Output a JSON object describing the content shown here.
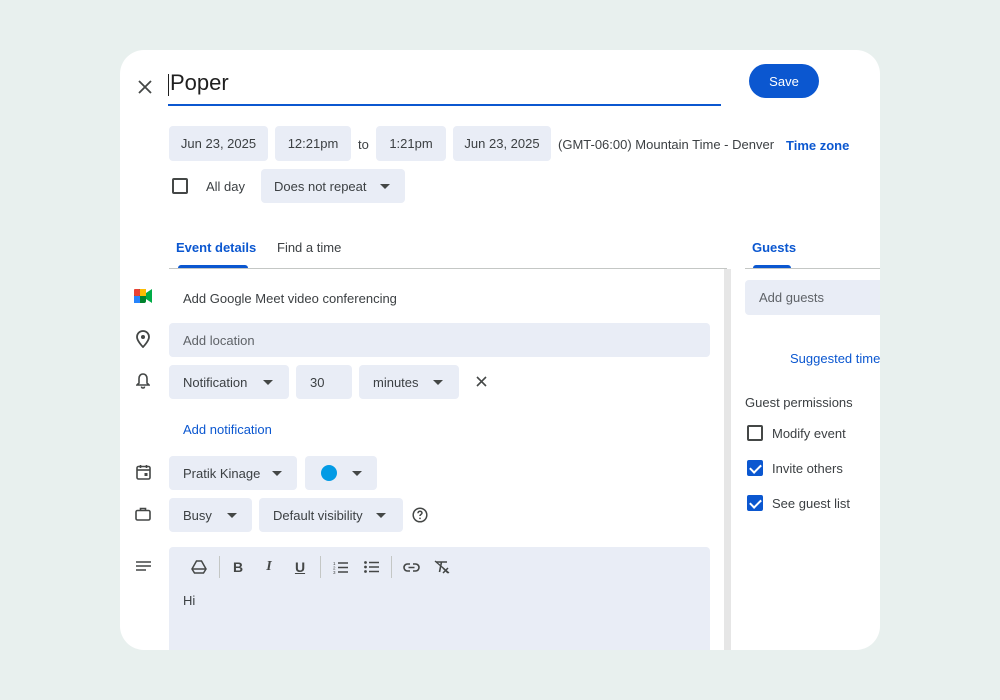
{
  "header": {
    "title": "Poper",
    "save_label": "Save"
  },
  "datetime": {
    "start_date": "Jun 23, 2025",
    "start_time": "12:21pm",
    "to_label": "to",
    "end_time": "1:21pm",
    "end_date": "Jun 23, 2025",
    "timezone_text": "(GMT-06:00) Mountain Time - Denver",
    "timezone_link": "Time zone",
    "all_day_label": "All day",
    "repeat_value": "Does not repeat"
  },
  "tabs": {
    "event_details": "Event details",
    "find_a_time": "Find a time",
    "guests": "Guests"
  },
  "details": {
    "meet_label": "Add Google Meet video conferencing",
    "location_placeholder": "Add location",
    "notification_type": "Notification",
    "notification_value": "30",
    "notification_unit": "minutes",
    "add_notification": "Add notification",
    "calendar_owner": "Pratik Kinage",
    "calendar_color": "#039be5",
    "availability": "Busy",
    "visibility": "Default visibility",
    "description_text": "Hi"
  },
  "guests": {
    "add_guests_placeholder": "Add guests",
    "suggested_times": "Suggested time",
    "permissions_heading": "Guest permissions",
    "permissions": [
      {
        "label": "Modify event",
        "checked": false
      },
      {
        "label": "Invite others",
        "checked": true
      },
      {
        "label": "See guest list",
        "checked": true
      }
    ]
  },
  "colors": {
    "accent": "#0b57d0",
    "field_bg": "#e9edf6",
    "page_bg": "#e8f0ee"
  }
}
